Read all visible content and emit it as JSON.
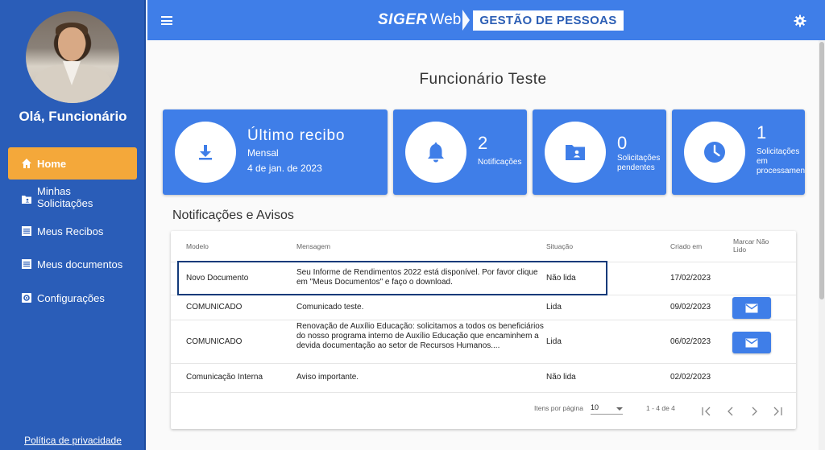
{
  "sidebar": {
    "greeting": "Olá, Funcionário",
    "items": [
      {
        "label": "Home",
        "icon": "home-icon",
        "active": true
      },
      {
        "label": "Minhas Solicitações",
        "icon": "folder-user-icon"
      },
      {
        "label": "Meus Recibos",
        "icon": "list-document-icon"
      },
      {
        "label": "Meus documentos",
        "icon": "list-document-icon"
      },
      {
        "label": "Configurações",
        "icon": "gear-square-icon"
      }
    ],
    "privacy_link": "Política de privacidade"
  },
  "header": {
    "brand_siger": "SIGER",
    "brand_web": "Web",
    "brand_module": "GESTÃO DE PESSOAS",
    "accent_color": "#3f7ee8"
  },
  "main": {
    "page_title": "Funcionário Teste",
    "cards": {
      "receipt": {
        "title": "Último recibo",
        "type": "Mensal",
        "date": "4 de jan. de 2023",
        "icon": "download-icon"
      },
      "notifications": {
        "count": "2",
        "label": "Notificações",
        "icon": "bell-icon"
      },
      "pending": {
        "count": "0",
        "label_line1": "Solicitações",
        "label_line2": "pendentes",
        "icon": "folder-user-icon"
      },
      "processing": {
        "count": "1",
        "label_line1": "Solicitações",
        "label_line2": "em",
        "label_line3": "processamento",
        "icon": "clock-icon"
      }
    },
    "section_title": "Notificações e Avisos",
    "table": {
      "headers": {
        "modelo": "Modelo",
        "mensagem": "Mensagem",
        "situacao": "Situação",
        "criado": "Criado em",
        "marcar": "Marcar Não Lido"
      },
      "rows": [
        {
          "modelo": "Novo Documento",
          "mensagem": "Seu Informe de Rendimentos 2022 está disponível. Por favor clique em \"Meus Documentos\" e faço o download.",
          "situacao": "Não lida",
          "criado": "17/02/2023",
          "has_button": false
        },
        {
          "modelo": "COMUNICADO",
          "mensagem": "Comunicado teste.",
          "situacao": "Lida",
          "criado": "09/02/2023",
          "has_button": true
        },
        {
          "modelo": "COMUNICADO",
          "mensagem": "Renovação de Auxílio Educação: solicitamos a todos os beneficiários do nosso programa interno de Auxílio Educação que encaminhem a devida documentação ao setor de Recursos Humanos....",
          "situacao": "Lida",
          "criado": "06/02/2023",
          "has_button": true
        },
        {
          "modelo": "Comunicação Interna",
          "mensagem": "Aviso importante.",
          "situacao": "Não lida",
          "criado": "02/02/2023",
          "has_button": false
        }
      ],
      "pagination": {
        "items_per_page_label": "Itens por página",
        "items_per_page": "10",
        "range": "1 - 4 de 4"
      }
    }
  }
}
